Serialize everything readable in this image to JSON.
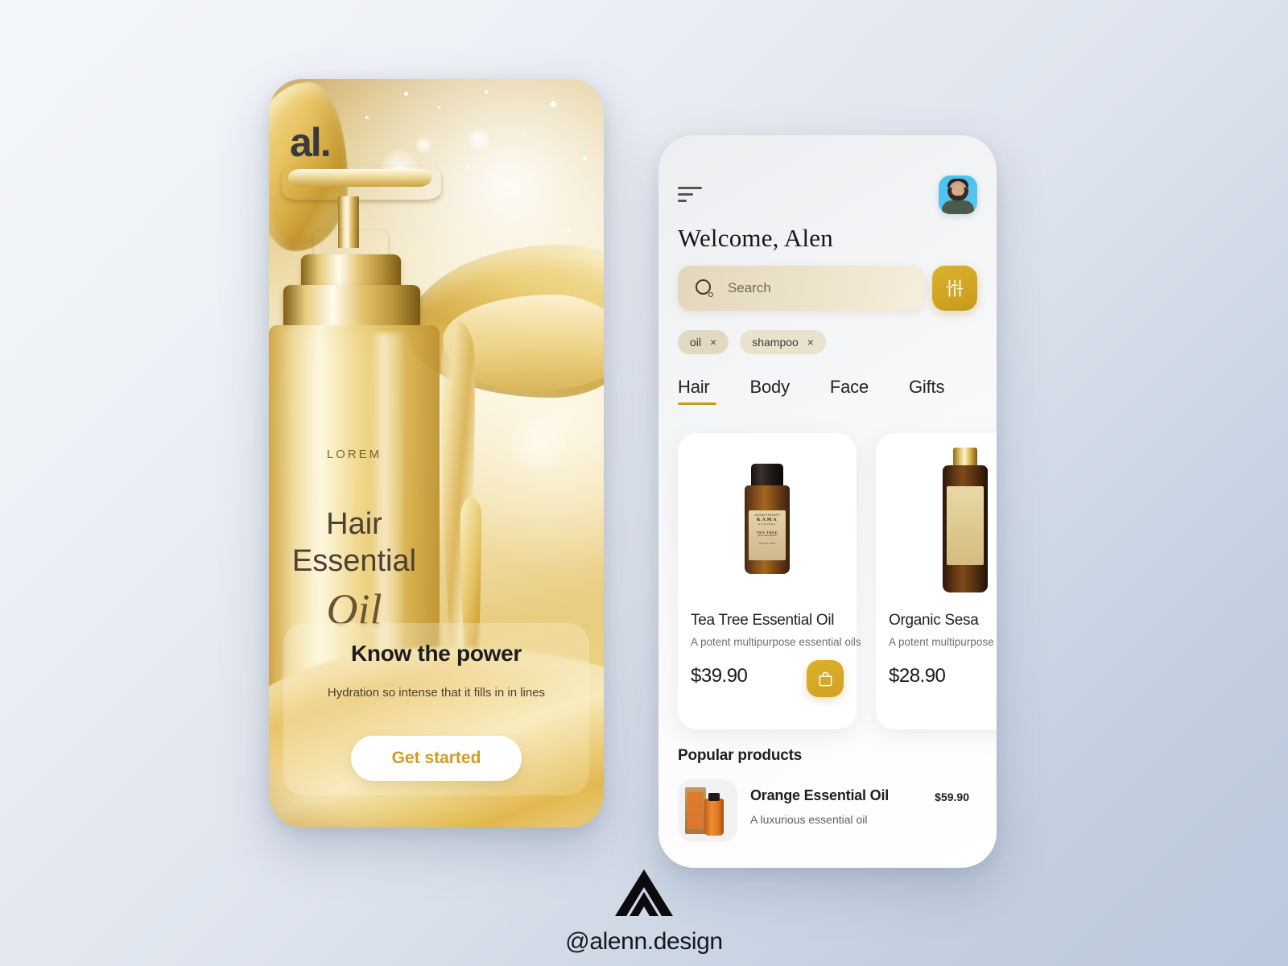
{
  "onboarding": {
    "brand_logo": "al.",
    "bottle_label": {
      "brand": "LOREM",
      "line1": "Hair",
      "line2": "Essential",
      "line3": "Oil"
    },
    "cta": {
      "title": "Know the power",
      "subtitle": "Hydration so intense that it fills in in lines",
      "button_label": "Get started"
    }
  },
  "app": {
    "menu_icon": "hamburger-menu-icon",
    "avatar_alt": "user-avatar",
    "welcome_title": "Welcome, Alen",
    "search": {
      "placeholder": "Search",
      "value": "",
      "icon": "search-icon"
    },
    "filter_icon": "sliders-filter-icon",
    "chips": [
      {
        "label": "oil",
        "close": "×"
      },
      {
        "label": "shampoo",
        "close": "×"
      }
    ],
    "tabs": [
      {
        "label": "Hair",
        "active": true
      },
      {
        "label": "Body",
        "active": false
      },
      {
        "label": "Face",
        "active": false
      },
      {
        "label": "Gifts",
        "active": false
      }
    ],
    "products": [
      {
        "name": "Tea Tree Essential Oil",
        "desc": "A potent multipurpose essential oils",
        "price": "$39.90",
        "bag_icon": "shopping-bag-icon",
        "label": {
          "l1": "AROMA THERAPY",
          "l2": "KAMA",
          "l3": "AYURVEDA",
          "l4": "TEA TREE",
          "l5": "pure essential oil",
          "l6": "0.41 fl oz / 12ml"
        }
      },
      {
        "name": "Organic Sesa",
        "desc": "A potent multipurpose es",
        "price": "$28.90"
      }
    ],
    "popular_section_title": "Popular products",
    "popular": [
      {
        "name": "Orange Essential Oil",
        "desc": "A luxurious essential oil",
        "price": "$59.90"
      }
    ]
  },
  "footer": {
    "handle": "@alenn.design",
    "logo": "alenn-triangle-logo"
  },
  "colors": {
    "gold": "#d2a422",
    "gold_dark": "#c79a1c",
    "chip_bg": "#e2d9c2",
    "search_bg": "#ece2c9",
    "page_bg_start": "#f4f7fa",
    "page_bg_end": "#bcc9dd",
    "text_dark": "#1d1f24"
  }
}
